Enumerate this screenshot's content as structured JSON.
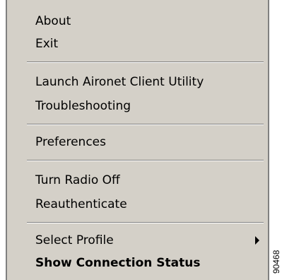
{
  "menu": {
    "items": [
      {
        "label": "About"
      },
      {
        "label": "Exit"
      },
      {
        "label": "Launch Aironet Client Utility"
      },
      {
        "label": "Troubleshooting"
      },
      {
        "label": "Preferences"
      },
      {
        "label": "Turn Radio Off"
      },
      {
        "label": "Reauthenticate"
      },
      {
        "label": "Select Profile"
      },
      {
        "label": "Show Connection Status"
      }
    ]
  },
  "figure_id": "90468"
}
